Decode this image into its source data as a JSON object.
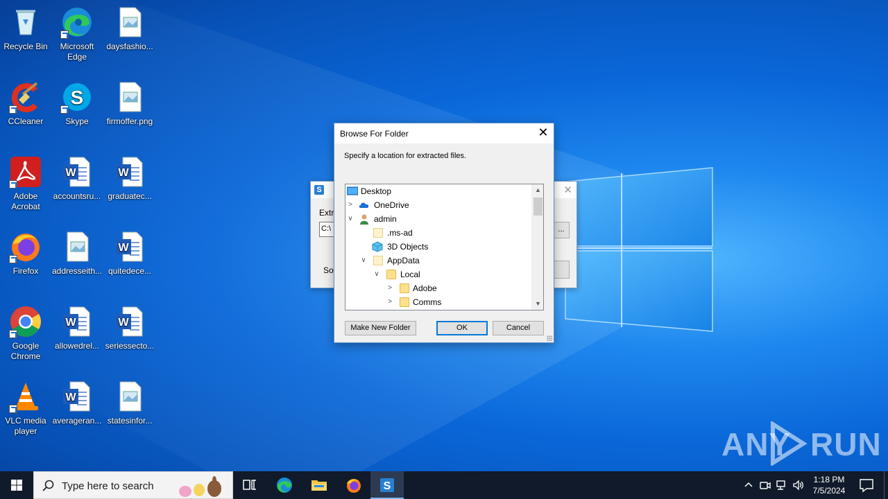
{
  "desktop": {
    "icons": [
      {
        "label": "Recycle Bin"
      },
      {
        "label": "Microsoft Edge"
      },
      {
        "label": "daysfashio..."
      },
      {
        "label": "CCleaner"
      },
      {
        "label": "Skype"
      },
      {
        "label": "firmoffer.png"
      },
      {
        "label": "Adobe Acrobat"
      },
      {
        "label": "accountsru..."
      },
      {
        "label": "graduatec..."
      },
      {
        "label": "Firefox"
      },
      {
        "label": "addresseith..."
      },
      {
        "label": "quitedece..."
      },
      {
        "label": "Google Chrome"
      },
      {
        "label": "allowedrel..."
      },
      {
        "label": "seriessecto..."
      },
      {
        "label": "VLC media player"
      },
      {
        "label": "averageran..."
      },
      {
        "label": "statesinfor..."
      }
    ]
  },
  "back_dialog": {
    "title_fragment": "S",
    "extract_label_fragment": "Extra",
    "path_fragment": "C:\\",
    "software_label_fragment": "Sof",
    "browse_label": "..."
  },
  "browse_dialog": {
    "title": "Browse For Folder",
    "description": "Specify a location for extracted files.",
    "tree": [
      {
        "label": "Desktop",
        "level": 0,
        "expander": "",
        "icon": "desktop-icon"
      },
      {
        "label": "OneDrive",
        "level": 1,
        "expander": "collapsed",
        "icon": "onedrive-icon"
      },
      {
        "label": "admin",
        "level": 1,
        "expander": "expanded",
        "icon": "user-icon"
      },
      {
        "label": ".ms-ad",
        "level": 2,
        "expander": "",
        "icon": "folder-icon"
      },
      {
        "label": "3D Objects",
        "level": 2,
        "expander": "",
        "icon": "3d-objects-icon"
      },
      {
        "label": "AppData",
        "level": 2,
        "expander": "expanded",
        "icon": "folder-icon"
      },
      {
        "label": "Local",
        "level": 3,
        "expander": "expanded",
        "icon": "folder-icon"
      },
      {
        "label": "Adobe",
        "level": 4,
        "expander": "collapsed",
        "icon": "folder-icon"
      },
      {
        "label": "Comms",
        "level": 4,
        "expander": "collapsed",
        "icon": "folder-icon"
      }
    ],
    "buttons": {
      "make_new_folder": "Make New Folder",
      "ok": "OK",
      "cancel": "Cancel"
    }
  },
  "watermark": {
    "left": "ANY",
    "right": "RUN"
  },
  "taskbar": {
    "search_placeholder": "Type here to search",
    "pinned": [
      "task-view",
      "edge",
      "file-explorer",
      "firefox",
      "sfx-app"
    ],
    "clock": {
      "time": "1:18 PM",
      "date": "7/5/2024"
    }
  }
}
